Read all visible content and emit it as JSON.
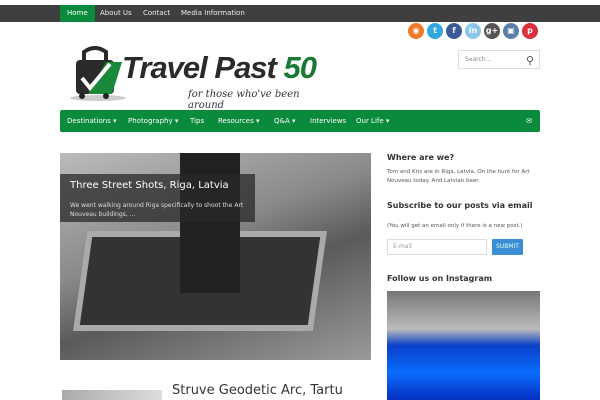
{
  "topnav": [
    "Home",
    "About Us",
    "Contact",
    "Media Information"
  ],
  "social": [
    {
      "name": "rss",
      "color": "#f07a2a",
      "glyph": "◉"
    },
    {
      "name": "twitter",
      "color": "#2fa8e0",
      "glyph": "t"
    },
    {
      "name": "facebook",
      "color": "#3b5a9a",
      "glyph": "f"
    },
    {
      "name": "linkedin",
      "color": "#8ac6e8",
      "glyph": "in"
    },
    {
      "name": "google-plus",
      "color": "#555",
      "glyph": "g+"
    },
    {
      "name": "instagram",
      "color": "#5a7fa8",
      "glyph": "▣"
    },
    {
      "name": "pinterest",
      "color": "#d9303a",
      "glyph": "p"
    }
  ],
  "search": {
    "placeholder": "Search..."
  },
  "logo": {
    "title_dark": "Travel Past ",
    "title_green": "50",
    "tagline": "for those who've been around"
  },
  "mainnav": [
    "Destinations ▾",
    "Photography ▾",
    "Tips",
    "Resources ▾",
    "Q&A ▾",
    "Interviews",
    "Our Life ▾"
  ],
  "featured": {
    "title": "Three Street Shots, Riga, Latvia",
    "excerpt": "We went walking around Riga specifically to shoot the Art Nouveau buildings, ..."
  },
  "post2": {
    "title": "Struve Geodetic Arc, Tartu"
  },
  "sidebar": {
    "where_title": "Where are we?",
    "where_text": "Tom and Kris are in Riga, Latvia. On the hunt for Art Nouveau today. And Latvian beer.",
    "subscribe_title": "Subscribe to our posts via email",
    "subscribe_note": "(You will get an email only if there is a new post.)",
    "email_placeholder": "E-mail",
    "submit": "SUBMIT",
    "instagram_title": "Follow us on Instagram"
  }
}
